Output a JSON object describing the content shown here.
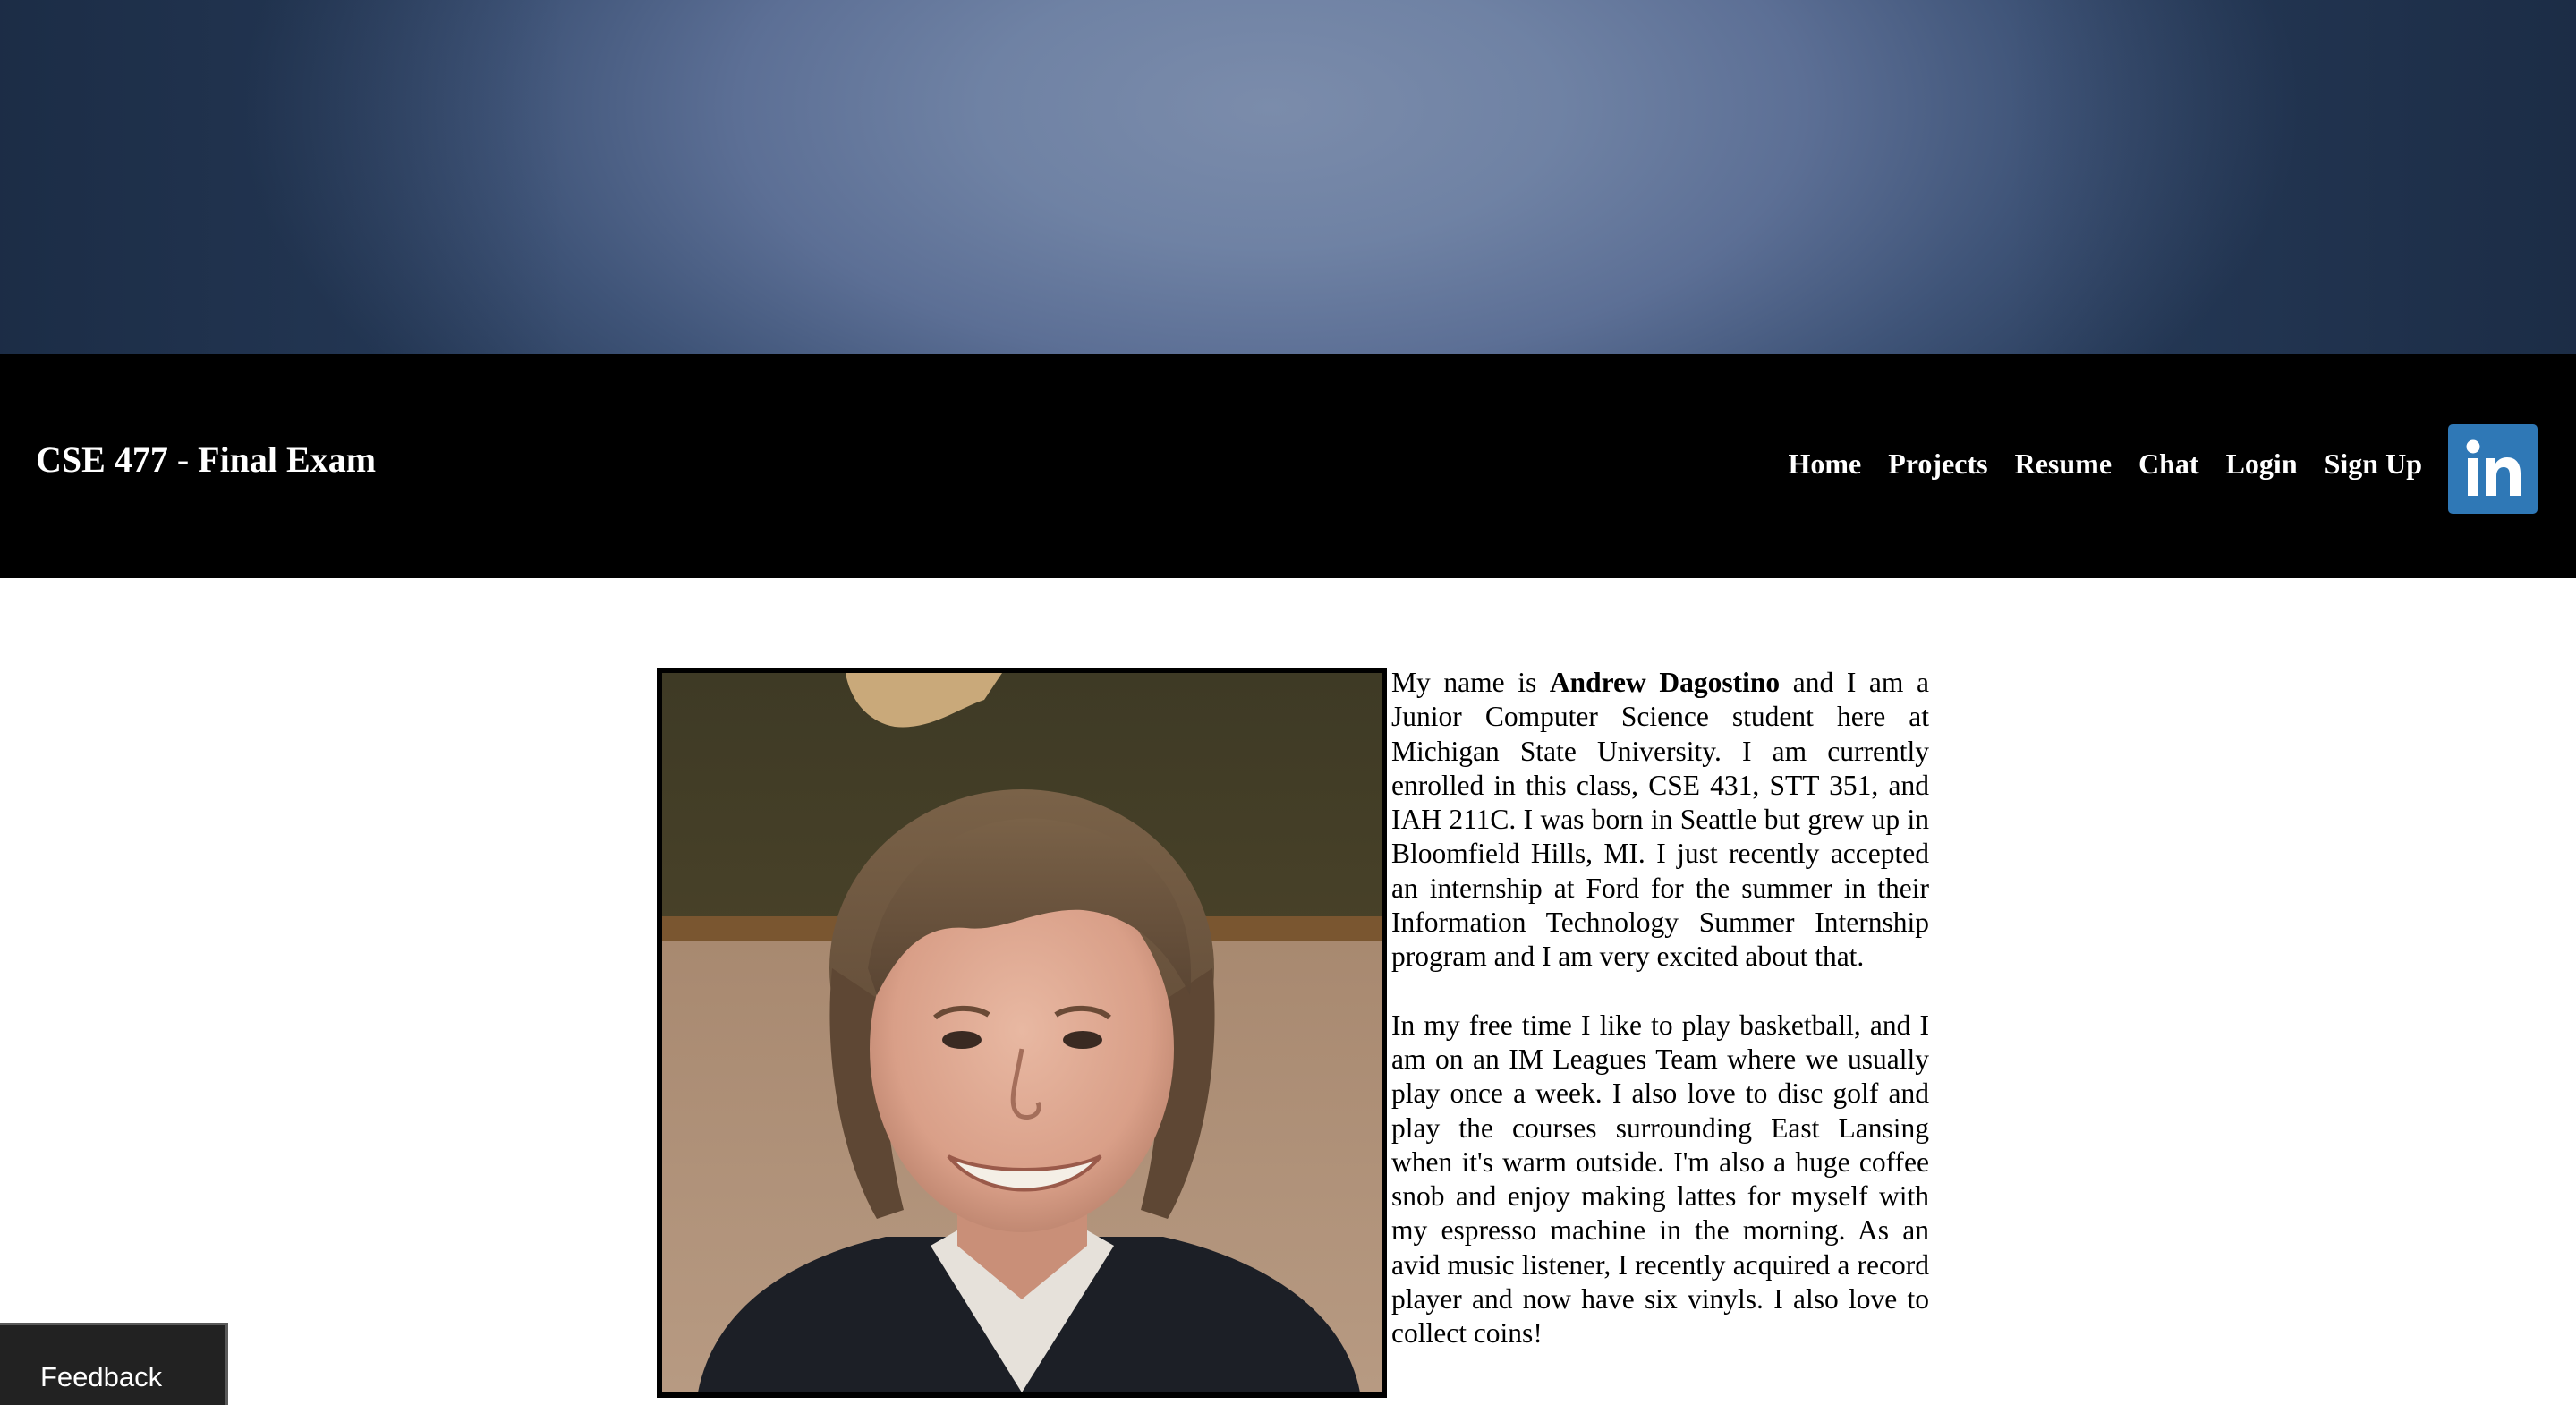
{
  "header": {
    "site_title": "CSE 477 - Final Exam",
    "nav": [
      {
        "label": "Home"
      },
      {
        "label": "Projects"
      },
      {
        "label": "Resume"
      },
      {
        "label": "Chat"
      },
      {
        "label": "Login"
      },
      {
        "label": "Sign Up"
      }
    ],
    "linkedin_icon": "linkedin-icon",
    "linkedin_color": "#2f78b6",
    "navbar_color": "#000000"
  },
  "main": {
    "bio": {
      "p1_before": "My name is ",
      "name": "Andrew Dagostino",
      "p1_after": " and I am a Junior Computer Science student here at Michigan State University. I am currently enrolled in this class, CSE 431, STT 351, and IAH 211C. I was born in Seattle but grew up in Bloomfield Hills, MI. I just recently accepted an internship at Ford for the summer in their Information Technology Summer Internship program and I am very excited about that.",
      "p2": "In my free time I like to play basketball, and I am on an IM Leagues Team where we usually play once a week. I also love to disc golf and play the courses surrounding East Lansing when it's warm outside. I'm also a huge coffee snob and enjoy making lattes for myself with my espresso machine in the morning. As an avid music listener, I recently acquired a record player and now have six vinyls. I also love to collect coins!"
    }
  },
  "feedback": {
    "label": "Feedback"
  }
}
